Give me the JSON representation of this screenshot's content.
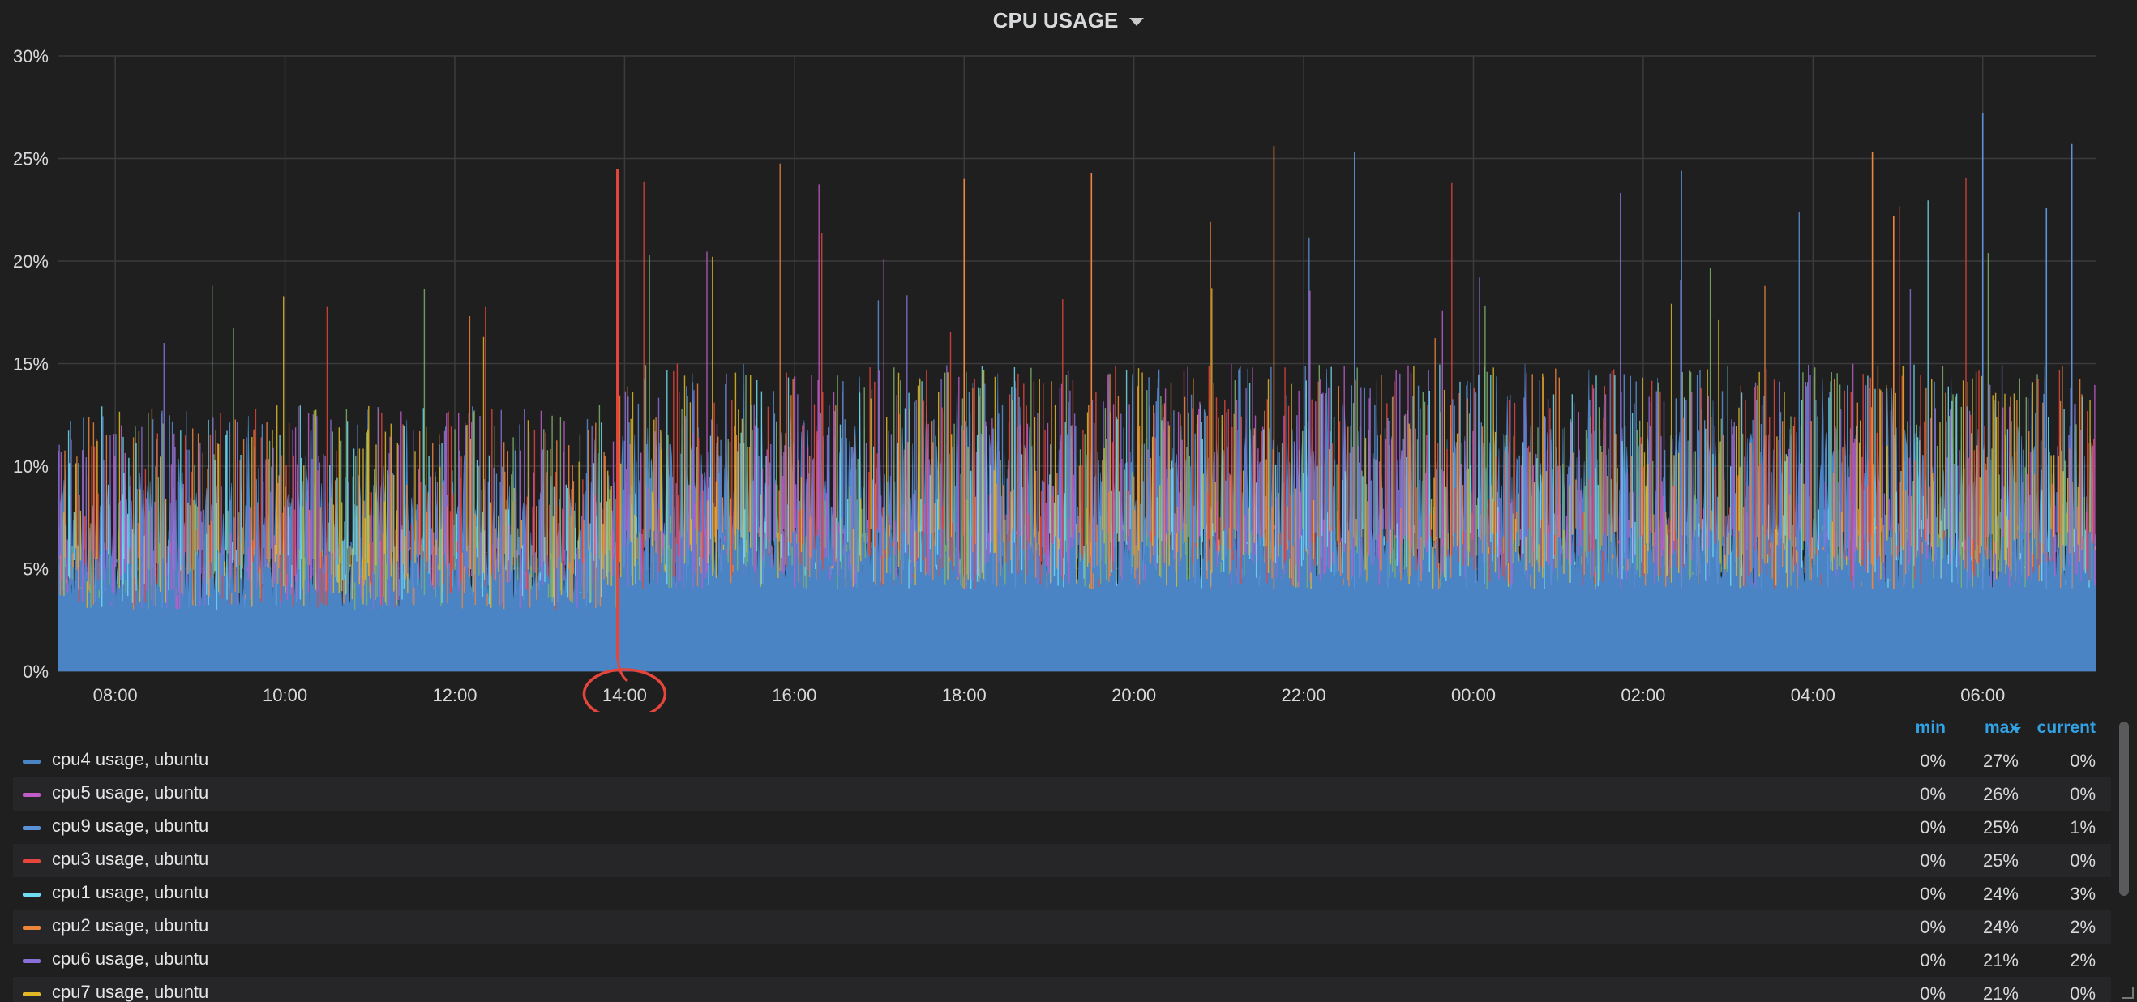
{
  "panel": {
    "title": "CPU USAGE"
  },
  "chart_data": {
    "type": "area",
    "title": "CPU USAGE",
    "xlabel": "",
    "ylabel": "",
    "ylim": [
      0,
      30
    ],
    "y_ticks": [
      "0%",
      "5%",
      "10%",
      "15%",
      "20%",
      "25%",
      "30%"
    ],
    "x_ticks": [
      "08:00",
      "10:00",
      "12:00",
      "14:00",
      "16:00",
      "18:00",
      "20:00",
      "22:00",
      "00:00",
      "02:00",
      "04:00",
      "06:00"
    ],
    "x_range_hours": [
      7.33,
      31.33
    ],
    "grid": true,
    "stacked": false,
    "base_series": {
      "name": "cpu4 usage, ubuntu",
      "color": "#4a84c4",
      "baseline_before_1400": 3,
      "baseline_after_1400": 4,
      "typical_range": [
        3,
        15
      ]
    },
    "annotations": [
      {
        "type": "vertical-line",
        "x": "13:55",
        "y": 24.5,
        "color": "#e5453a"
      },
      {
        "type": "circle",
        "target": "14:00",
        "color": "#e5453a"
      }
    ],
    "series_colors": [
      "#4a84c4",
      "#c15cc7",
      "#5b91d6",
      "#e5453a",
      "#6fdcef",
      "#ef843c",
      "#8a6fd6",
      "#e0b827",
      "#7eb26d"
    ]
  },
  "legend": {
    "headers": {
      "min": "min",
      "max": "max",
      "current": "current"
    },
    "sort_icon": "caret-down-icon",
    "rows": [
      {
        "name": "cpu4 usage, ubuntu",
        "color": "#4a84c4",
        "min": "0%",
        "max": "27%",
        "current": "0%"
      },
      {
        "name": "cpu5 usage, ubuntu",
        "color": "#c15cc7",
        "min": "0%",
        "max": "26%",
        "current": "0%"
      },
      {
        "name": "cpu9 usage, ubuntu",
        "color": "#5b91d6",
        "min": "0%",
        "max": "25%",
        "current": "1%"
      },
      {
        "name": "cpu3 usage, ubuntu",
        "color": "#e5453a",
        "min": "0%",
        "max": "25%",
        "current": "0%"
      },
      {
        "name": "cpu1 usage, ubuntu",
        "color": "#6fdcef",
        "min": "0%",
        "max": "24%",
        "current": "3%"
      },
      {
        "name": "cpu2 usage, ubuntu",
        "color": "#ef843c",
        "min": "0%",
        "max": "24%",
        "current": "2%"
      },
      {
        "name": "cpu6 usage, ubuntu",
        "color": "#8a6fd6",
        "min": "0%",
        "max": "21%",
        "current": "2%"
      },
      {
        "name": "cpu7 usage, ubuntu",
        "color": "#e0b827",
        "min": "0%",
        "max": "21%",
        "current": "0%"
      }
    ]
  }
}
